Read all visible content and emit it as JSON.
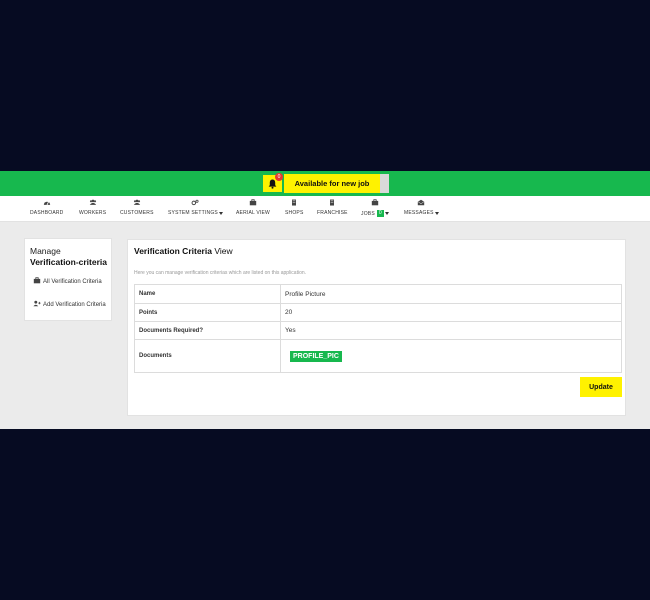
{
  "topbar": {
    "bell_icon": "bell-icon",
    "notification_count": "0",
    "availability_label": "Available for new job",
    "accent": "#17b84e",
    "highlight": "#fff200"
  },
  "nav": {
    "items": [
      {
        "label": "DASHBOARD",
        "icon": "dashboard-icon"
      },
      {
        "label": "WORKERS",
        "icon": "users-icon"
      },
      {
        "label": "CUSTOMERS",
        "icon": "users-icon"
      },
      {
        "label": "SYSTEM SETTINGS",
        "icon": "gears-icon"
      },
      {
        "label": "AERIAL VIEW",
        "icon": "briefcase-icon"
      },
      {
        "label": "SHOPS",
        "icon": "building-icon"
      },
      {
        "label": "FRANCHISE",
        "icon": "building-icon"
      },
      {
        "label": "JOBS",
        "icon": "briefcase-icon",
        "badge": "0"
      },
      {
        "label": "MESSAGES",
        "icon": "envelope-icon"
      }
    ]
  },
  "sidebar": {
    "title_line1": "Manage",
    "title_line2": "Verification-criteria",
    "items": [
      {
        "label": "All Verification Criteria",
        "icon": "briefcase-icon"
      },
      {
        "label": "Add Verification Criteria",
        "icon": "user-plus-icon"
      }
    ]
  },
  "main": {
    "title_bold": "Verification Criteria",
    "title_rest": " View",
    "subtitle": "Here you can manage verification criterias which are listed on this application.",
    "rows": [
      {
        "key": "Name",
        "value": "Profile Picture"
      },
      {
        "key": "Points",
        "value": "20"
      },
      {
        "key": "Documents Required?",
        "value": "Yes"
      },
      {
        "key": "Documents",
        "tag": "PROFILE_PIC"
      }
    ],
    "update_label": "Update"
  }
}
